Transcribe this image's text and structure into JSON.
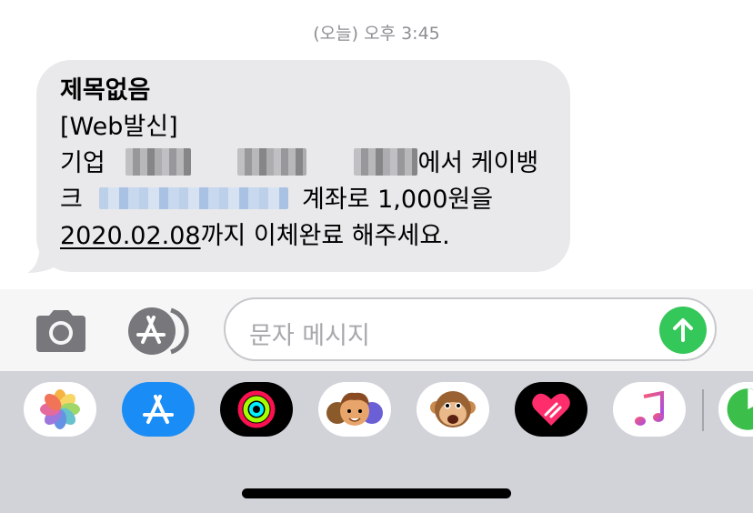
{
  "header": {
    "timestamp": "(오늘) 오후 3:45"
  },
  "message": {
    "subject": "제목없음",
    "line2": "[Web발신]",
    "line3_prefix": "기업",
    "line3_suffix": "에서 케이뱅",
    "line4_prefix": "크",
    "line4_suffix": "계좌로 1,000원을",
    "line5_date": "2020.02.08",
    "line5_suffix": "까지 이체완료 해주세요."
  },
  "composer": {
    "placeholder": "문자 메시지"
  },
  "app_drawer": {
    "apps": [
      "photos-icon",
      "app-store-icon",
      "activity-icon",
      "memoji-icon",
      "animoji-monkey-icon",
      "digital-touch-icon",
      "music-icon",
      "partial-app-icon"
    ]
  },
  "colors": {
    "bubble_bg": "#e9e9eb",
    "send_green": "#34c759",
    "app_store_blue": "#1a8cf5",
    "drawer_bg": "#d1d3d9",
    "timestamp_gray": "#8e8e93"
  }
}
